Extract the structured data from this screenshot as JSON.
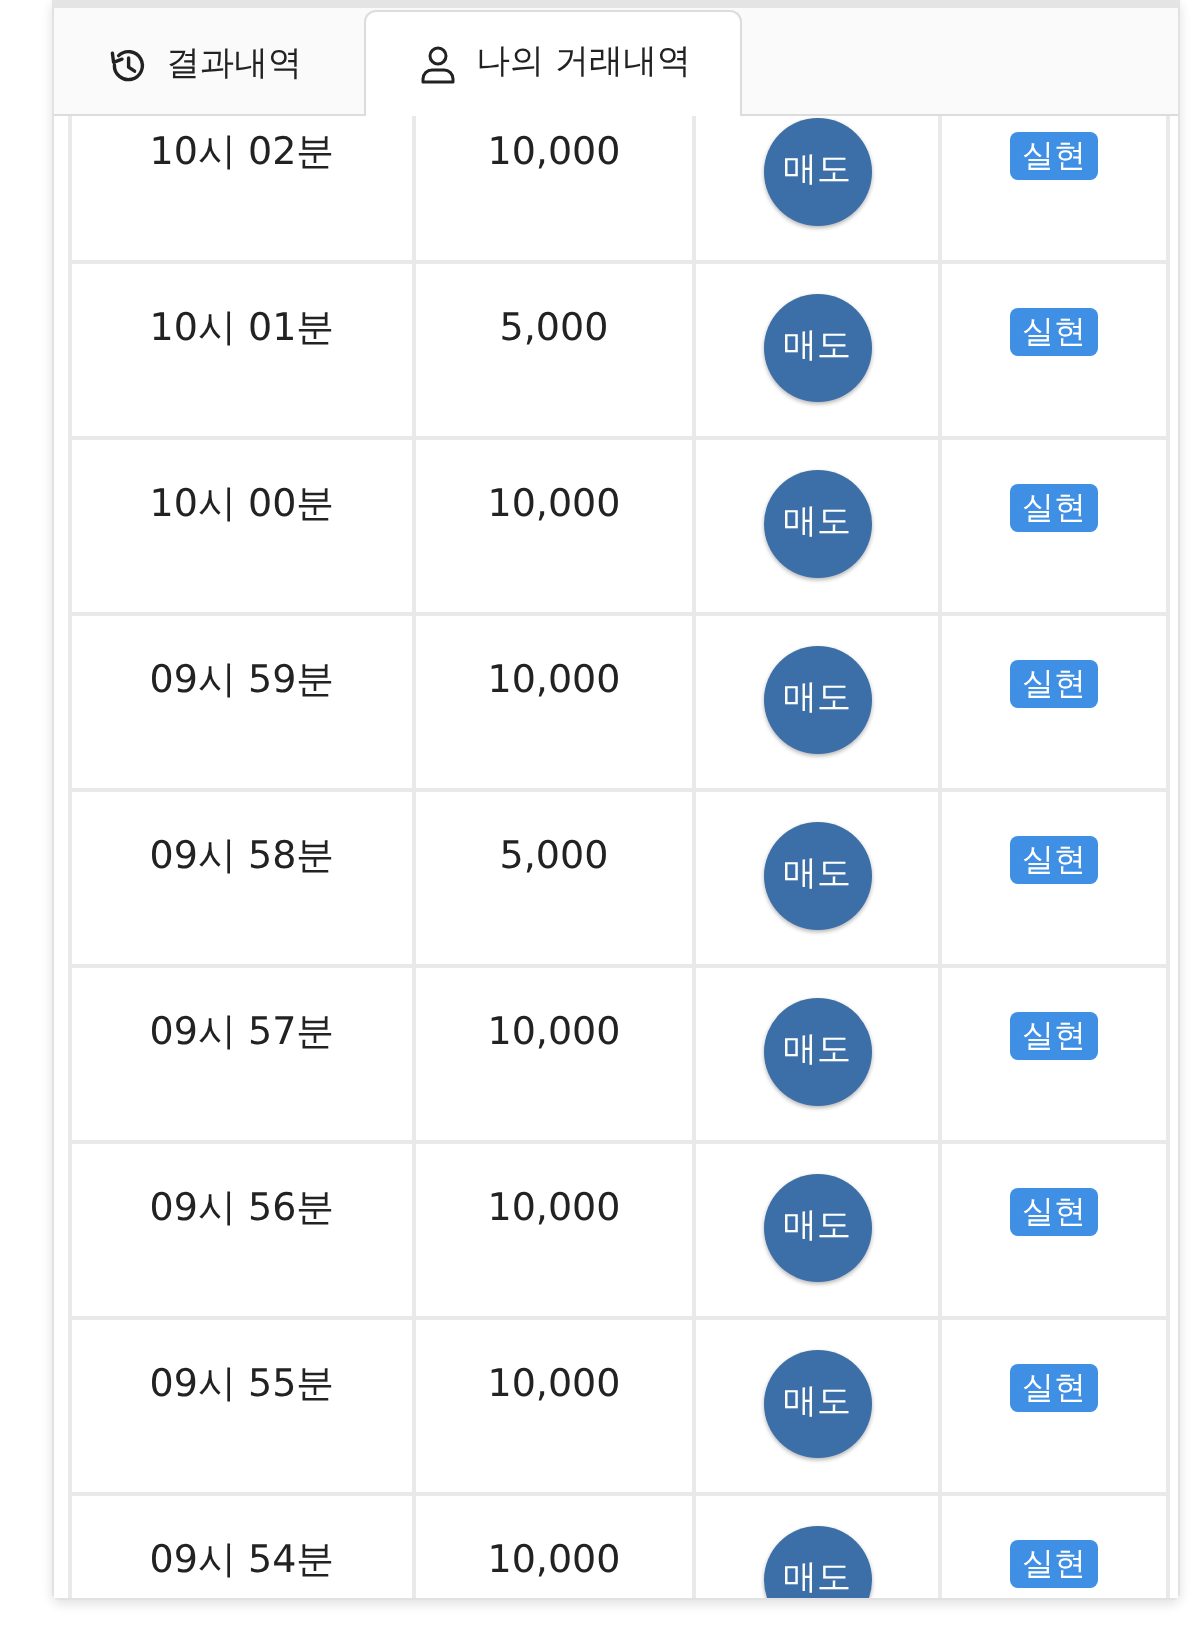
{
  "tabs": [
    {
      "label": "결과내역",
      "selected": false
    },
    {
      "label": "나의 거래내역",
      "selected": true
    }
  ],
  "table": {
    "rows": [
      {
        "time": "10시 02분",
        "amount": "10,000",
        "side": "매도",
        "status": "실현"
      },
      {
        "time": "10시 01분",
        "amount": "5,000",
        "side": "매도",
        "status": "실현"
      },
      {
        "time": "10시 00분",
        "amount": "10,000",
        "side": "매도",
        "status": "실현"
      },
      {
        "time": "09시 59분",
        "amount": "10,000",
        "side": "매도",
        "status": "실현"
      },
      {
        "time": "09시 58분",
        "amount": "5,000",
        "side": "매도",
        "status": "실현"
      },
      {
        "time": "09시 57분",
        "amount": "10,000",
        "side": "매도",
        "status": "실현"
      },
      {
        "time": "09시 56분",
        "amount": "10,000",
        "side": "매도",
        "status": "실현"
      },
      {
        "time": "09시 55분",
        "amount": "10,000",
        "side": "매도",
        "status": "실현"
      },
      {
        "time": "09시 54분",
        "amount": "10,000",
        "side": "매도",
        "status": "실현"
      }
    ]
  }
}
